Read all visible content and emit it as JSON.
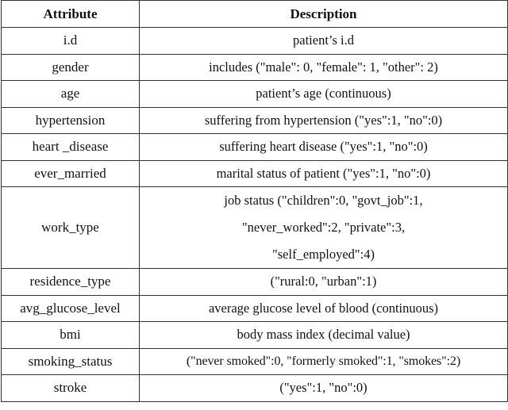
{
  "table": {
    "headers": [
      "Attribute",
      "Description"
    ],
    "rows": [
      {
        "attribute": "i.d",
        "description": [
          "patient’s i.d"
        ]
      },
      {
        "attribute": "gender",
        "description": [
          "includes (\"male\": 0, \"female\": 1, \"other\": 2)"
        ]
      },
      {
        "attribute": "age",
        "description": [
          "patient’s age (continuous)"
        ]
      },
      {
        "attribute": "hypertension",
        "description": [
          "suffering from hypertension (\"yes\":1, \"no\":0)"
        ]
      },
      {
        "attribute": "heart _disease",
        "description": [
          "suffering heart disease (\"yes\":1, \"no\":0)"
        ]
      },
      {
        "attribute": "ever_married",
        "description": [
          "marital status of patient (\"yes\":1, \"no\":0)"
        ]
      },
      {
        "attribute": "work_type",
        "description": [
          "job status (\"children\":0, \"govt_job\":1,",
          "\"never_worked\":2, \"private\":3,",
          "\"self_employed\":4)"
        ]
      },
      {
        "attribute": "residence_type",
        "description": [
          "(\"rural:0, \"urban\":1)"
        ]
      },
      {
        "attribute": "avg_glucose_level",
        "description": [
          "average glucose level of blood (continuous)"
        ]
      },
      {
        "attribute": "bmi",
        "description": [
          "body mass index (decimal value)"
        ]
      },
      {
        "attribute": "smoking_status",
        "description": [
          "(\"never smoked\":0, \"formerly smoked\":1, \"smokes\":2)"
        ]
      },
      {
        "attribute": "stroke",
        "description": [
          "(\"yes\":1, \"no\":0)"
        ]
      }
    ]
  }
}
